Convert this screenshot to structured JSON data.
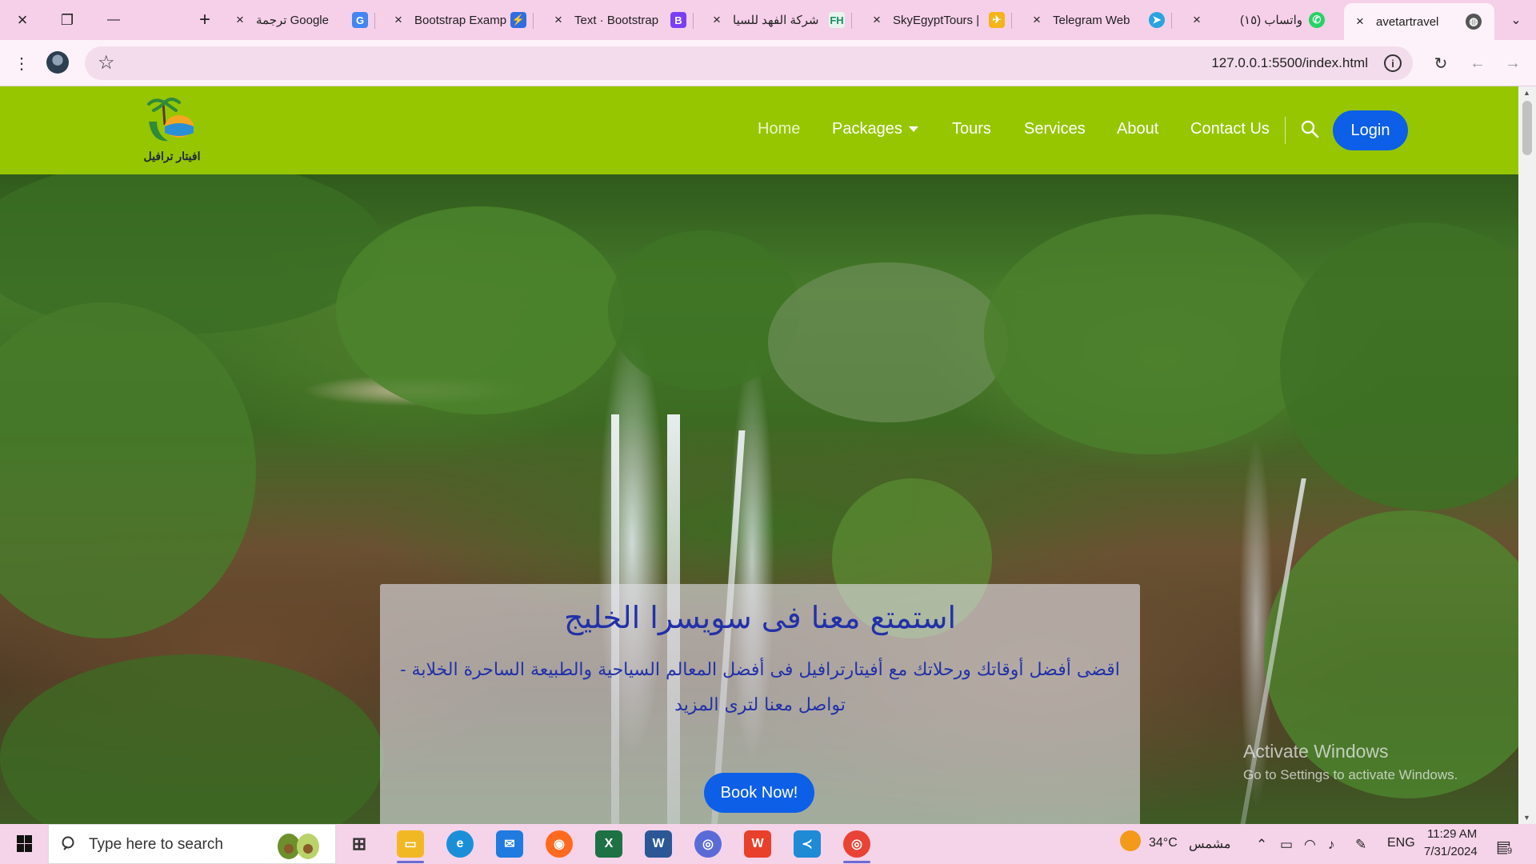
{
  "browser": {
    "window_controls": {
      "close": "×",
      "restore": "❐",
      "minimize": "—",
      "new_tab": "+"
    },
    "tabs": [
      {
        "title": "ترجمة Google",
        "icon": "google-translate-icon",
        "color": "#4285f4"
      },
      {
        "title": "Bootstrap Examp",
        "icon": "bolt-icon",
        "color": "#2f6de1"
      },
      {
        "title": "Text · Bootstrap",
        "icon": "bootstrap-icon",
        "color": "#7a3ff2"
      },
      {
        "title": "شركة الفهد للسيا",
        "icon": "fh-icon",
        "color": "#1a8f5c"
      },
      {
        "title": "SkyEgyptTours |",
        "icon": "skyegypt-icon",
        "color": "#f4b41a"
      },
      {
        "title": "Telegram Web",
        "icon": "telegram-icon",
        "color": "#2aa3df"
      },
      {
        "title": "(١٥) واتساب",
        "icon": "whatsapp-icon",
        "color": "#25d366"
      },
      {
        "title": "avetartravel",
        "icon": "globe-icon",
        "color": "#555555",
        "active": true
      }
    ],
    "url": "127.0.0.1:5500/index.html"
  },
  "site": {
    "logo_text": "افيتار ترافيل",
    "nav": {
      "home": "Home",
      "packages": "Packages",
      "tours": "Tours",
      "services": "Services",
      "about": "About",
      "contact": "Contact Us",
      "login": "Login"
    },
    "hero": {
      "title": "استمتع معنا فى سويسرا الخليج",
      "subtitle": "اقضى أفضل أوقاتك ورحلاتك مع أفيتارترافيل فى أفضل المعالم السياحية والطبيعة الساحرة الخلابة - تواصل معنا لترى المزيد",
      "cta": "Book Now!"
    },
    "colors": {
      "navbar": "#96c600",
      "button": "#0d5fe8",
      "hero_text": "#2231a8"
    }
  },
  "watermark": {
    "line1": "Activate Windows",
    "line2": "Go to Settings to activate Windows."
  },
  "taskbar": {
    "search_placeholder": "Type here to search",
    "weather": {
      "temp": "34°C",
      "label": "مشمس"
    },
    "lang": "ENG",
    "time": "11:29 AM",
    "date": "7/31/2024",
    "notifications": "9"
  }
}
